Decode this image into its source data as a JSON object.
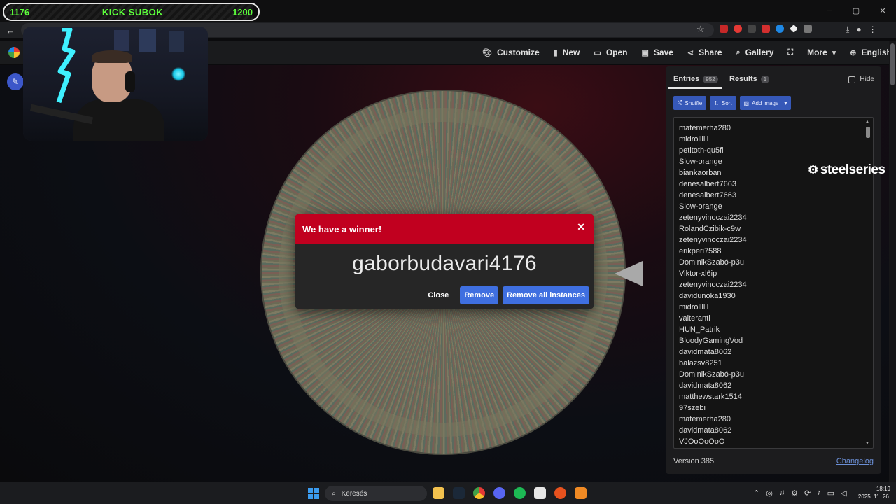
{
  "overlay": {
    "subgoal": {
      "current": "1176",
      "title": "KICK SUBOK",
      "goal": "1200",
      "progress": 0.98
    },
    "steelseries_brand": "steelseries"
  },
  "nav": {
    "items": [
      {
        "label": "Customize",
        "icon": "palette-icon"
      },
      {
        "label": "New",
        "icon": "file-icon"
      },
      {
        "label": "Open",
        "icon": "folder-icon"
      },
      {
        "label": "Save",
        "icon": "save-icon"
      },
      {
        "label": "Share",
        "icon": "share-icon"
      },
      {
        "label": "Gallery",
        "icon": "search-icon"
      },
      {
        "label": "",
        "icon": "fullscreen-icon"
      },
      {
        "label": "More",
        "icon": "chevron-down-icon"
      },
      {
        "label": "English",
        "icon": "globe-icon"
      }
    ]
  },
  "dialog": {
    "title": "We have a winner!",
    "winner": "gaborbudavari4176",
    "close_label": "Close",
    "remove_label": "Remove",
    "remove_all_label": "Remove all instances",
    "header_color": "#c1001f"
  },
  "panel": {
    "tab_entries": "Entries",
    "entries_count": "952",
    "tab_results": "Results",
    "results_count": "1",
    "hide_label": "Hide",
    "shuffle_label": "Shuffle",
    "sort_label": "Sort",
    "add_image_label": "Add image",
    "entries": [
      "matemerha280",
      "midrollllll",
      "petitoth-qu5fl",
      "Slow-orange",
      "biankaorban",
      "denesalbert7663",
      "denesalbert7663",
      "Slow-orange",
      "zetenyvinoczai2234",
      "RolandCzibik-c9w",
      "zetenyvinoczai2234",
      "erikperi7588",
      "DominikSzabó-p3u",
      "Viktor-xl6ip",
      "zetenyvinoczai2234",
      "davidunoka1930",
      "midrollllll",
      "valteranti",
      "HUN_Patrik",
      "BloodyGamingVod",
      "davidmata8062",
      "balazsv8251",
      "DominikSzabó-p3u",
      "davidmata8062",
      "matthewstark1514",
      "97szebi",
      "matemerha280",
      "davidmata8062",
      "VJOoOoOoO"
    ],
    "version": "Version 385",
    "changelog": "Changelog"
  },
  "taskbar": {
    "search_placeholder": "Keresés",
    "time": "18:19",
    "date": "2025. 11. 26."
  },
  "colors": {
    "accent_blue": "#3f6fe0",
    "subgoal_green": "#5cff3b"
  }
}
